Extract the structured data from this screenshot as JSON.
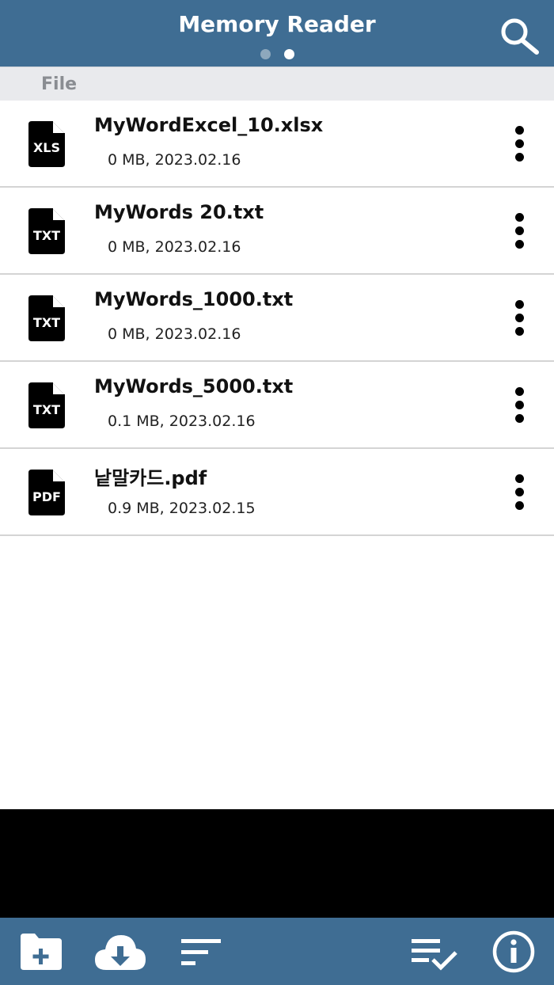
{
  "header": {
    "title": "Memory Reader",
    "search_icon": "search-icon",
    "pager": {
      "count": 2,
      "active_index": 1
    }
  },
  "section": {
    "label": "File"
  },
  "files": [
    {
      "name": "MyWordExcel_10.xlsx",
      "meta": "0 MB, 2023.02.16",
      "type_label": "XLS"
    },
    {
      "name": "MyWords 20.txt",
      "meta": "0 MB, 2023.02.16",
      "type_label": "TXT"
    },
    {
      "name": "MyWords_1000.txt",
      "meta": "0 MB, 2023.02.16",
      "type_label": "TXT"
    },
    {
      "name": "MyWords_5000.txt",
      "meta": "0.1 MB, 2023.02.16",
      "type_label": "TXT"
    },
    {
      "name": "낱말카드.pdf",
      "meta": "0.9 MB, 2023.02.15",
      "type_label": "PDF"
    }
  ],
  "toolbar": {
    "icons": [
      "add-folder-icon",
      "cloud-download-icon",
      "sort-icon",
      "select-list-icon",
      "info-icon"
    ]
  },
  "colors": {
    "header_bg": "#3f6d93",
    "section_bg": "#e9eaed",
    "section_text": "#8a8d92",
    "divider": "#d4d4d4",
    "ad_bg": "#000000"
  }
}
